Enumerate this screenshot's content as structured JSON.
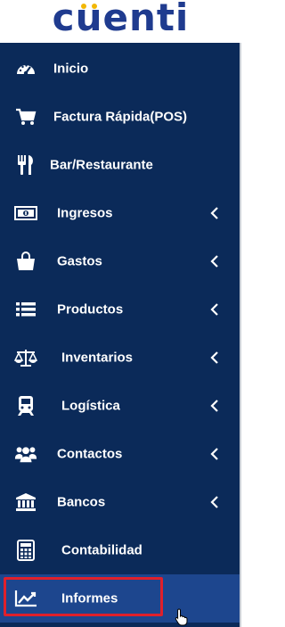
{
  "brand": {
    "logo_text": "cuenti"
  },
  "colors": {
    "sidebar_bg": "#0b2a59",
    "active_bg": "#1d468e",
    "highlight": "#e0202b",
    "logo": "#1f3b8f",
    "logo_accent": "#f2b705"
  },
  "sidebar": {
    "items": [
      {
        "label": "Inicio",
        "icon": "dashboard-gauge-icon",
        "has_submenu": false
      },
      {
        "label": "Factura Rápida(POS)",
        "icon": "shopping-cart-icon",
        "has_submenu": false
      },
      {
        "label": "Bar/Restaurante",
        "icon": "fork-knife-icon",
        "has_submenu": false
      },
      {
        "label": "Ingresos",
        "icon": "money-bill-icon",
        "has_submenu": true
      },
      {
        "label": "Gastos",
        "icon": "shopping-bag-icon",
        "has_submenu": true
      },
      {
        "label": "Productos",
        "icon": "list-icon",
        "has_submenu": true
      },
      {
        "label": "Inventarios",
        "icon": "balance-scale-icon",
        "has_submenu": true
      },
      {
        "label": "Logística",
        "icon": "train-icon",
        "has_submenu": true
      },
      {
        "label": "Contactos",
        "icon": "users-icon",
        "has_submenu": true
      },
      {
        "label": "Bancos",
        "icon": "bank-icon",
        "has_submenu": true
      },
      {
        "label": "Contabilidad",
        "icon": "calculator-icon",
        "has_submenu": false
      },
      {
        "label": "Informes",
        "icon": "line-chart-icon",
        "has_submenu": false,
        "active": true
      }
    ]
  }
}
